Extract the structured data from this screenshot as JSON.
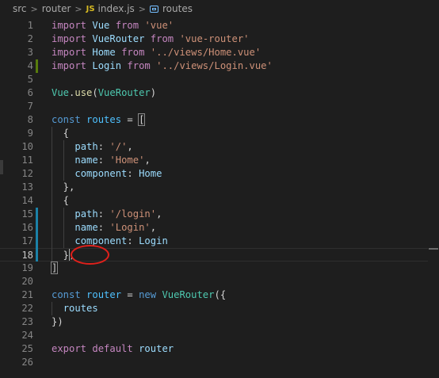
{
  "breadcrumb": {
    "items": [
      "src",
      "router",
      "index.js",
      "routes"
    ],
    "file_icon": "JS",
    "separator": ">"
  },
  "editor": {
    "language": "javascript",
    "cursor": {
      "line": 18,
      "column": 4
    },
    "highlighted_line": 18,
    "lines": [
      [
        {
          "t": "import",
          "c": "kw-ctrl"
        },
        {
          "t": " "
        },
        {
          "t": "Vue",
          "c": "var"
        },
        {
          "t": " "
        },
        {
          "t": "from",
          "c": "kw-ctrl"
        },
        {
          "t": " "
        },
        {
          "t": "'vue'",
          "c": "str"
        }
      ],
      [
        {
          "t": "import",
          "c": "kw-ctrl"
        },
        {
          "t": " "
        },
        {
          "t": "VueRouter",
          "c": "var"
        },
        {
          "t": " "
        },
        {
          "t": "from",
          "c": "kw-ctrl"
        },
        {
          "t": " "
        },
        {
          "t": "'vue-router'",
          "c": "str"
        }
      ],
      [
        {
          "t": "import",
          "c": "kw-ctrl"
        },
        {
          "t": " "
        },
        {
          "t": "Home",
          "c": "var"
        },
        {
          "t": " "
        },
        {
          "t": "from",
          "c": "kw-ctrl"
        },
        {
          "t": " "
        },
        {
          "t": "'../views/Home.vue'",
          "c": "str"
        }
      ],
      [
        {
          "t": "import",
          "c": "kw-ctrl"
        },
        {
          "t": " "
        },
        {
          "t": "Login",
          "c": "var"
        },
        {
          "t": " "
        },
        {
          "t": "from",
          "c": "kw-ctrl"
        },
        {
          "t": " "
        },
        {
          "t": "'../views/Login.vue'",
          "c": "str"
        }
      ],
      [],
      [
        {
          "t": "Vue",
          "c": "cls"
        },
        {
          "t": "."
        },
        {
          "t": "use",
          "c": "fn"
        },
        {
          "t": "("
        },
        {
          "t": "VueRouter",
          "c": "cls"
        },
        {
          "t": ")"
        }
      ],
      [],
      [
        {
          "t": "const",
          "c": "kw"
        },
        {
          "t": " "
        },
        {
          "t": "routes",
          "c": "const"
        },
        {
          "t": " = "
        },
        {
          "t": "[",
          "c": "bracket-match"
        }
      ],
      [
        {
          "t": "  {"
        }
      ],
      [
        {
          "t": "    "
        },
        {
          "t": "path",
          "c": "var"
        },
        {
          "t": ": "
        },
        {
          "t": "'/'",
          "c": "str"
        },
        {
          "t": ","
        }
      ],
      [
        {
          "t": "    "
        },
        {
          "t": "name",
          "c": "var"
        },
        {
          "t": ": "
        },
        {
          "t": "'Home'",
          "c": "str"
        },
        {
          "t": ","
        }
      ],
      [
        {
          "t": "    "
        },
        {
          "t": "component",
          "c": "var"
        },
        {
          "t": ": "
        },
        {
          "t": "Home",
          "c": "var"
        }
      ],
      [
        {
          "t": "  },"
        }
      ],
      [
        {
          "t": "  {"
        }
      ],
      [
        {
          "t": "    "
        },
        {
          "t": "path",
          "c": "var"
        },
        {
          "t": ": "
        },
        {
          "t": "'/login'",
          "c": "str"
        },
        {
          "t": ","
        }
      ],
      [
        {
          "t": "    "
        },
        {
          "t": "name",
          "c": "var"
        },
        {
          "t": ": "
        },
        {
          "t": "'Login'",
          "c": "str"
        },
        {
          "t": ","
        }
      ],
      [
        {
          "t": "    "
        },
        {
          "t": "component",
          "c": "var"
        },
        {
          "t": ": "
        },
        {
          "t": "Login",
          "c": "var"
        }
      ],
      [
        {
          "t": "  },"
        }
      ],
      [
        {
          "t": "]",
          "c": "bracket-match"
        }
      ],
      [],
      [
        {
          "t": "const",
          "c": "kw"
        },
        {
          "t": " "
        },
        {
          "t": "router",
          "c": "const"
        },
        {
          "t": " = "
        },
        {
          "t": "new",
          "c": "kw"
        },
        {
          "t": " "
        },
        {
          "t": "VueRouter",
          "c": "cls"
        },
        {
          "t": "({"
        }
      ],
      [
        {
          "t": "  "
        },
        {
          "t": "routes",
          "c": "var"
        }
      ],
      [
        {
          "t": "})"
        }
      ],
      [],
      [
        {
          "t": "export",
          "c": "kw-ctrl"
        },
        {
          "t": " "
        },
        {
          "t": "default",
          "c": "kw-ctrl"
        },
        {
          "t": " "
        },
        {
          "t": "router",
          "c": "var"
        }
      ],
      []
    ],
    "decorations": [
      {
        "line": 4,
        "kind": "modified",
        "color": "#587c0c"
      },
      {
        "line": 15,
        "kind": "modified",
        "color": "#1b81a8"
      },
      {
        "line": 16,
        "kind": "modified",
        "color": "#1b81a8"
      },
      {
        "line": 17,
        "kind": "modified",
        "color": "#1b81a8"
      },
      {
        "line": 18,
        "kind": "modified",
        "color": "#1b81a8"
      }
    ]
  },
  "annotation": {
    "kind": "hand-drawn-circle",
    "color": "#e0201b",
    "line": 18
  }
}
